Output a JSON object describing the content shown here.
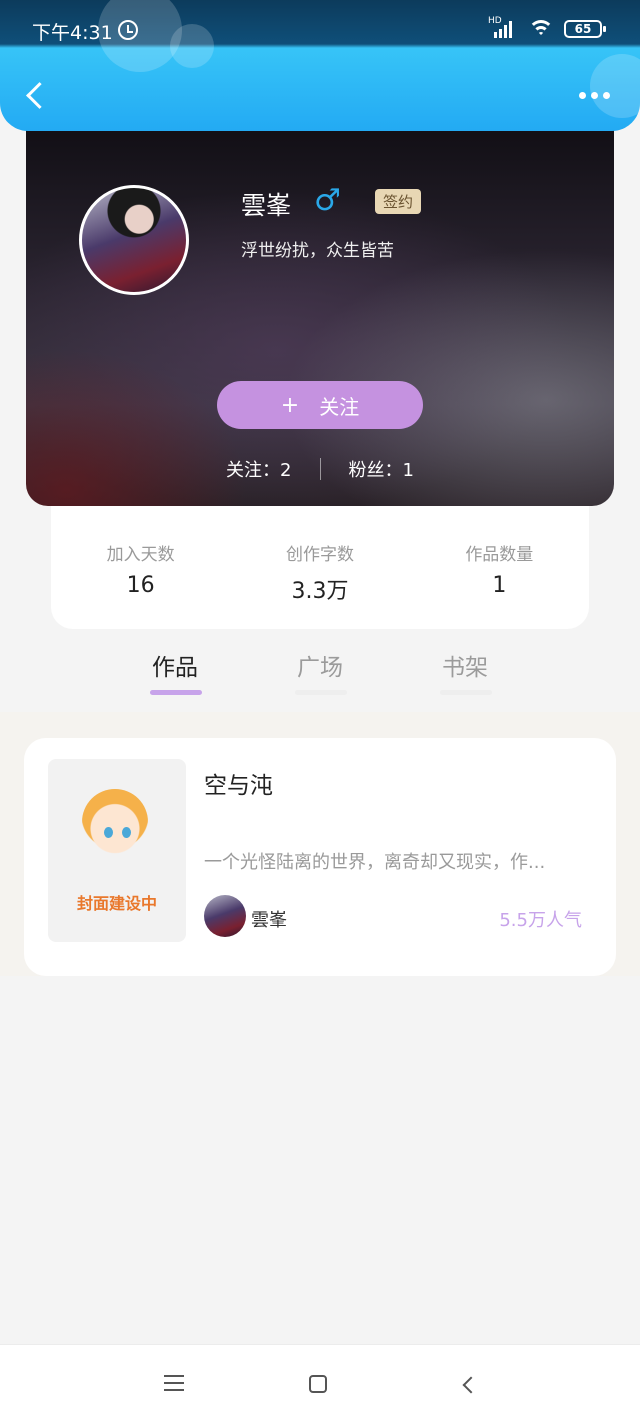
{
  "status_bar": {
    "time": "下午4:31",
    "network": "HD",
    "battery": "65"
  },
  "nav": {
    "back_icon": "chevron-left-icon",
    "more_icon": "more-horizontal-icon"
  },
  "profile": {
    "name": "雲峯",
    "gender_icon": "♂",
    "badge": "签约",
    "motto": "浮世纷扰，众生皆苦",
    "follow_icon": "+",
    "follow_label": "关注",
    "following": "关注：2",
    "followers": "粉丝：1"
  },
  "stats": [
    {
      "label": "加入天数",
      "value": "16"
    },
    {
      "label": "创作字数",
      "value": "3.3万"
    },
    {
      "label": "作品数量",
      "value": "1"
    }
  ],
  "tabs": [
    {
      "label": "作品",
      "active": true
    },
    {
      "label": "广场",
      "active": false
    },
    {
      "label": "书架",
      "active": false
    }
  ],
  "works": [
    {
      "cover_text": "封面建设中",
      "title": "空与沌",
      "description": "一个光怪陆离的世界，离奇却又现实，作...",
      "author": "雲峯",
      "popularity": "5.5万人气"
    }
  ],
  "colors": {
    "accent": "#c592e0",
    "header_blue": "#23aaf3",
    "badge_bg": "#e8d7b4"
  }
}
